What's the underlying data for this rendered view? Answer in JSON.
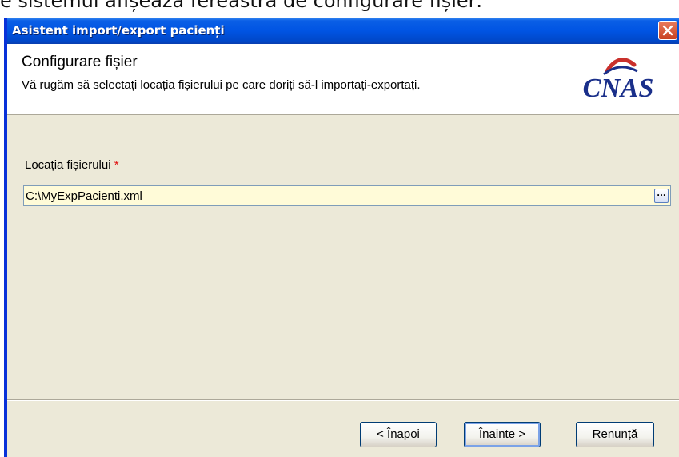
{
  "caption": "e sistemul afișează fereastra de configurare fișier:",
  "window": {
    "title": "Asistent import/export pacienți"
  },
  "header": {
    "title": "Configurare fișier",
    "subtitle": "Vă rugăm să selectați locația fișierului pe care doriți să-l importați-exportați.",
    "logo_text": "CNAS"
  },
  "form": {
    "label": "Locația fișierului",
    "required_mark": "*",
    "value": "C:\\MyExpPacienti.xml",
    "browse_label": "..."
  },
  "buttons": {
    "back": "< Înapoi",
    "next": "Înainte >",
    "cancel": "Renunță"
  },
  "colors": {
    "titlebar": "#0054e3",
    "input_bg": "#fffbd8",
    "window_bg": "#ece9d8"
  }
}
